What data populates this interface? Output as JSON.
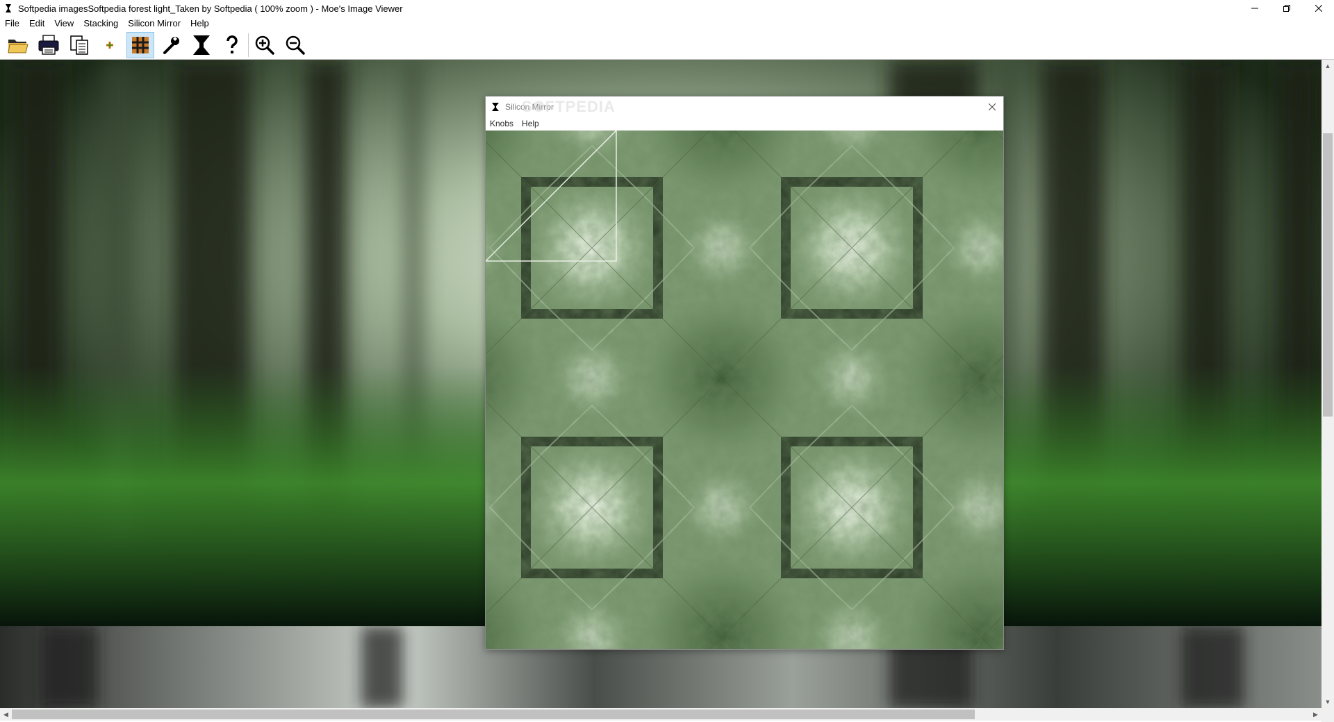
{
  "window": {
    "title": "Softpedia imagesSoftpedia forest light_Taken by Softpedia ( 100% zoom ) - Moe's Image Viewer"
  },
  "menu": {
    "items": [
      "File",
      "Edit",
      "View",
      "Stacking",
      "Silicon Mirror",
      "Help"
    ]
  },
  "toolbar": {
    "buttons": [
      "open-folder-icon",
      "print-icon",
      "copy-icon",
      "add-icon",
      "grid-icon",
      "wrench-icon",
      "silicon-mirror-icon",
      "help-icon",
      "zoom-in-icon",
      "zoom-out-icon"
    ]
  },
  "mirror": {
    "title": "Silicon Mirror",
    "watermark": "SOFTPEDIA",
    "menu": [
      "Knobs",
      "Help"
    ]
  },
  "colors": {
    "accent": "#3c6e3a",
    "toolbar_active": "#cde6f7"
  }
}
